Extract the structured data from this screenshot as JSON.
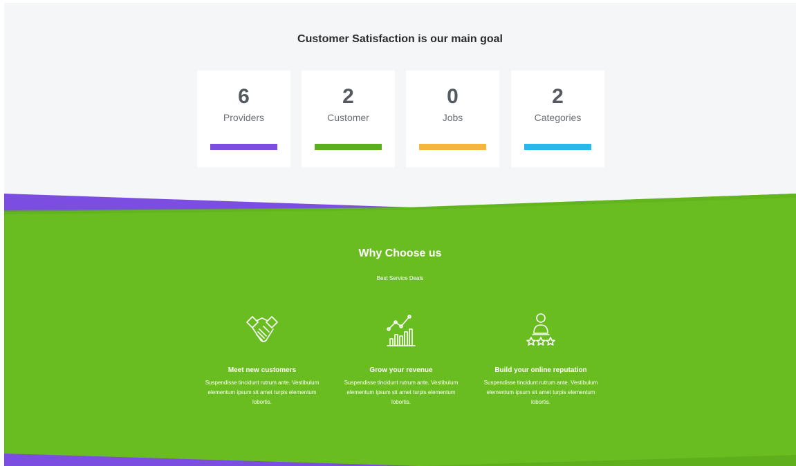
{
  "stats": {
    "heading": "Customer Satisfaction is our main goal",
    "cards": [
      {
        "number": "6",
        "label": "Providers",
        "color": "#7b4de0"
      },
      {
        "number": "2",
        "label": "Customer",
        "color": "#5aae1f"
      },
      {
        "number": "0",
        "label": "Jobs",
        "color": "#f5b53f"
      },
      {
        "number": "2",
        "label": "Categories",
        "color": "#2ab7ea"
      }
    ]
  },
  "why": {
    "title": "Why Choose us",
    "subtitle": "Best Service Deals",
    "features": [
      {
        "icon": "handshake-icon",
        "title": "Meet new customers",
        "text": "Suspendisse tincidunt rutrum ante. Vestibulum elementum ipsum sit amet turpis elementum lobortis."
      },
      {
        "icon": "growth-chart-icon",
        "title": "Grow your revenue",
        "text": "Suspendisse tincidunt rutrum ante. Vestibulum elementum ipsum sit amet turpis elementum lobortis."
      },
      {
        "icon": "user-rating-icon",
        "title": "Build your online reputation",
        "text": "Suspendisse tincidunt rutrum ante. Vestibulum elementum ipsum sit amet turpis elementum lobortis."
      }
    ]
  },
  "colors": {
    "purple": "#7b4de0",
    "green": "#6abd21",
    "light_bg": "#f5f6f8"
  }
}
